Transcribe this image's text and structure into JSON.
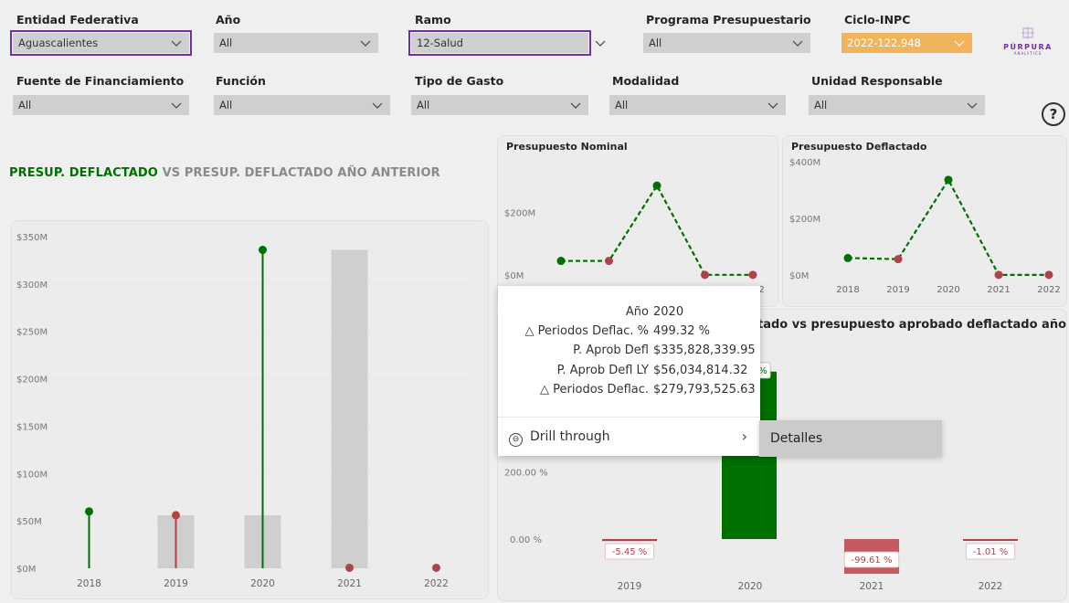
{
  "filters_row1": [
    {
      "label": "Entidad Federativa",
      "value": "Aguascalientes"
    },
    {
      "label": "Año",
      "value": "All"
    },
    {
      "label": "Ramo",
      "value": "12-Salud"
    },
    {
      "label": "Programa Presupuestario",
      "value": "All"
    },
    {
      "label": "Ciclo-INPC",
      "value": "2022-122.948"
    }
  ],
  "filters_row2": [
    {
      "label": "Fuente de Financiamiento",
      "value": "All"
    },
    {
      "label": "Función",
      "value": "All"
    },
    {
      "label": "Tipo de Gasto",
      "value": "All"
    },
    {
      "label": "Modalidad",
      "value": "All"
    },
    {
      "label": "Unidad Responsable",
      "value": "All"
    }
  ],
  "logo": {
    "name": "PÚRPURA",
    "sub": "ANALYTICS"
  },
  "help": {
    "glyph": "?"
  },
  "colors": {
    "green": "#007000",
    "red": "#b04248",
    "grey_bar": "#cfcfcf",
    "purple": "#7030a0",
    "orange": "#f2b45a"
  },
  "main_title": {
    "part1": "PRESUP. DEFLACTADO",
    "part2": "VS",
    "part3": "PRESUP. DEFLACTADO AÑO ANTERIOR"
  },
  "chart_data": [
    {
      "type": "bar",
      "title": "",
      "categories": [
        "2018",
        "2019",
        "2020",
        "2021",
        "2022"
      ],
      "y_ticks": [
        "$0M",
        "$50M",
        "$100M",
        "$150M",
        "$200M",
        "$250M",
        "$300M",
        "$350M"
      ],
      "ylim": [
        0,
        350
      ],
      "series": [
        {
          "name": "",
          "values": [
            null,
            56,
            56,
            336,
            null
          ]
        },
        {
          "name": "",
          "values": [
            60,
            56,
            336,
            0.5,
            0.5
          ]
        }
      ]
    },
    {
      "type": "line",
      "title": "Presupuesto Nominal",
      "categories": [
        "2018",
        "2019",
        "2020",
        "2021",
        "2022"
      ],
      "y_ticks": [
        "$0M",
        "$200M"
      ],
      "ylim": [
        0,
        300
      ],
      "series": [
        {
          "name": "",
          "values": [
            45,
            45,
            285,
            0.5,
            0.5
          ]
        }
      ]
    },
    {
      "type": "line",
      "title": "Presupuesto Deflactado",
      "categories": [
        "2018",
        "2019",
        "2020",
        "2021",
        "2022"
      ],
      "y_ticks": [
        "$0M",
        "$200M",
        "$400M"
      ],
      "ylim": [
        0,
        400
      ],
      "series": [
        {
          "name": "",
          "values": [
            60,
            56,
            336,
            0.5,
            0.5
          ]
        }
      ]
    },
    {
      "type": "bar",
      "title": "tado vs presupuesto aprobado deflactado año",
      "categories": [
        "2019",
        "2020",
        "2021",
        "2022"
      ],
      "y_ticks": [
        "0.00 %",
        "200.00 %"
      ],
      "values": [
        -5.45,
        499.32,
        -99.61,
        -1.01
      ],
      "labels": [
        "-5.45 %",
        "%",
        "-99.61 %",
        "-1.01 %"
      ]
    }
  ],
  "tooltip": {
    "rows": [
      {
        "k": "Año",
        "v": "2020"
      },
      {
        "k": "△ Periodos Deflac. %",
        "v": "499.32 %"
      },
      {
        "k": "P. Aprob Defl",
        "v": "$335,828,339.95"
      },
      {
        "k": "P. Aprob Defl LY",
        "v": "$56,034,814.32"
      },
      {
        "k": "△ Periodos Deflac.",
        "v": "$279,793,525.63"
      }
    ],
    "drill": "Drill through",
    "drill_icon": "⊖",
    "chevron": "›",
    "submenu": "Detalles"
  }
}
